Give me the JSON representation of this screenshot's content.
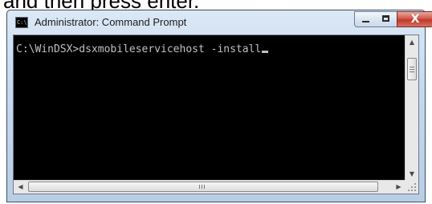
{
  "caption": "and then press enter.",
  "window": {
    "title": "Administrator: Command Prompt",
    "icon": "cmd-icon",
    "controls": {
      "minimize": "minimize-icon",
      "maximize": "maximize-icon",
      "close_label": "X"
    }
  },
  "console": {
    "prompt": "C:\\WinDSX>",
    "command": "dsxmobileservicehost -install"
  },
  "scrollbars": {
    "vertical": {
      "up": "▲",
      "down": "▼"
    },
    "horizontal": {
      "left": "◀",
      "right": "▶"
    }
  },
  "colors": {
    "console_bg": "#000000",
    "console_fg": "#c0c0c0",
    "close_button": "#c0392b"
  }
}
